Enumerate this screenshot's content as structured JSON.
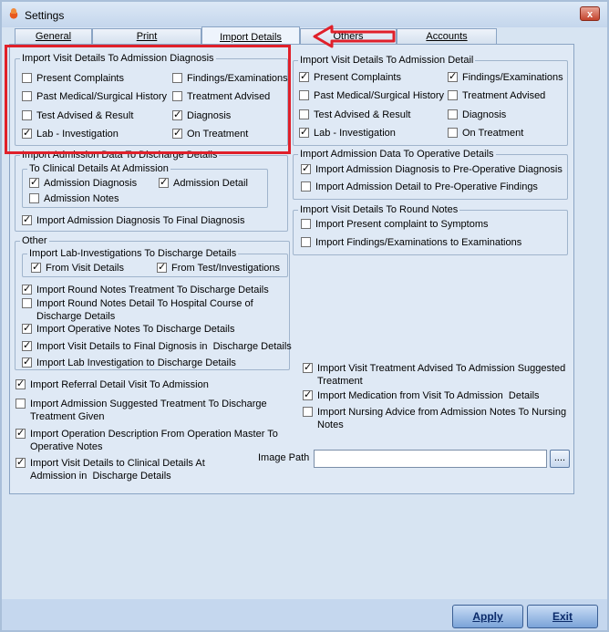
{
  "window": {
    "title": "Settings",
    "close_glyph": "x"
  },
  "tabs": [
    {
      "label": "General",
      "active": false
    },
    {
      "label": "Print",
      "active": false
    },
    {
      "label": "Import Details",
      "active": true
    },
    {
      "label": "Others",
      "active": false
    },
    {
      "label": "Accounts",
      "active": false
    }
  ],
  "left": {
    "visit_to_admission": {
      "title": "Import Visit Details To Admission Diagnosis",
      "items": [
        {
          "label": "Present Complaints",
          "checked": false
        },
        {
          "label": "Findings/Examinations",
          "checked": false
        },
        {
          "label": "Past Medical/Surgical History",
          "checked": false
        },
        {
          "label": "Treatment Advised",
          "checked": false
        },
        {
          "label": "Test Advised & Result",
          "checked": false
        },
        {
          "label": "Diagnosis",
          "checked": true
        },
        {
          "label": "Lab - Investigation",
          "checked": true
        },
        {
          "label": "On Treatment",
          "checked": true
        }
      ]
    },
    "admission_to_discharge": {
      "title": "Import Admission Data To Discharge Details",
      "clinical_title": "To Clinical Details At Admission",
      "clinical_items": [
        {
          "label": "Admission Diagnosis",
          "checked": true
        },
        {
          "label": "Admission Detail",
          "checked": true
        },
        {
          "label": "Admission Notes",
          "checked": false
        }
      ],
      "final_diagnosis": {
        "label": "Import Admission Diagnosis To Final Diagnosis",
        "checked": true
      }
    },
    "other": {
      "title": "Other",
      "lab_title": "Import Lab-Investigations To Discharge Details",
      "lab_items": [
        {
          "label": "From Visit Details",
          "checked": true
        },
        {
          "label": "From Test/Investigations",
          "checked": true
        }
      ],
      "items": [
        {
          "label": "Import Round Notes Treatment To Discharge Details",
          "checked": true
        },
        {
          "label": "Import Round Notes Detail To Hospital Course of\nDischarge Details",
          "checked": false
        },
        {
          "label": "Import Operative Notes To Discharge Details",
          "checked": true
        },
        {
          "label": "Import Visit Details to Final Dignosis in  Discharge Details",
          "checked": true
        },
        {
          "label": "Import Lab Investigation to Discharge Details",
          "checked": true
        }
      ]
    },
    "loose": [
      {
        "label": "Import Referral Detail Visit To Admission",
        "checked": true
      },
      {
        "label": "Import Admission Suggested Treatment To Discharge\nTreatment Given",
        "checked": false
      },
      {
        "label": "Import Operation Description From Operation Master To\nOperative Notes",
        "checked": true
      },
      {
        "label": "Import Visit Details to Clinical Details At\nAdmission in  Discharge Details",
        "checked": true
      }
    ]
  },
  "right": {
    "visit_to_admission_detail": {
      "title": "Import Visit Details To Admission Detail",
      "items": [
        {
          "label": "Present Complaints",
          "checked": true
        },
        {
          "label": "Findings/Examinations",
          "checked": true
        },
        {
          "label": "Past Medical/Surgical History",
          "checked": false
        },
        {
          "label": "Treatment Advised",
          "checked": false
        },
        {
          "label": "Test Advised & Result",
          "checked": false
        },
        {
          "label": "Diagnosis",
          "checked": false
        },
        {
          "label": "Lab - Investigation",
          "checked": true
        },
        {
          "label": "On Treatment",
          "checked": false
        }
      ]
    },
    "admission_to_operative": {
      "title": "Import Admission Data To Operative Details",
      "items": [
        {
          "label": "Import Admission Diagnosis to Pre-Operative Diagnosis",
          "checked": true
        },
        {
          "label": "Import Admission Detail to Pre-Operative Findings",
          "checked": false
        }
      ]
    },
    "visit_to_round_notes": {
      "title": "Import Visit Details To Round Notes",
      "items": [
        {
          "label": "Import Present complaint to Symptoms",
          "checked": false
        },
        {
          "label": "Import Findings/Examinations to Examinations",
          "checked": false
        }
      ]
    },
    "loose": [
      {
        "label": "Import Visit Treatment Advised To Admission Suggested\nTreatment",
        "checked": true
      },
      {
        "label": "Import Medication from Visit To Admission  Details",
        "checked": true
      },
      {
        "label": "Import Nursing Advice from Admission Notes To Nursing\nNotes",
        "checked": false
      }
    ]
  },
  "image_path": {
    "label": "Image Path",
    "value": "",
    "browse_label": "...."
  },
  "buttons": {
    "apply": "Apply",
    "exit": "Exit"
  },
  "colors": {
    "annotation": "#e0202a",
    "button_bg": "#7aa3d8",
    "panel_bg": "#dfe9f5"
  }
}
